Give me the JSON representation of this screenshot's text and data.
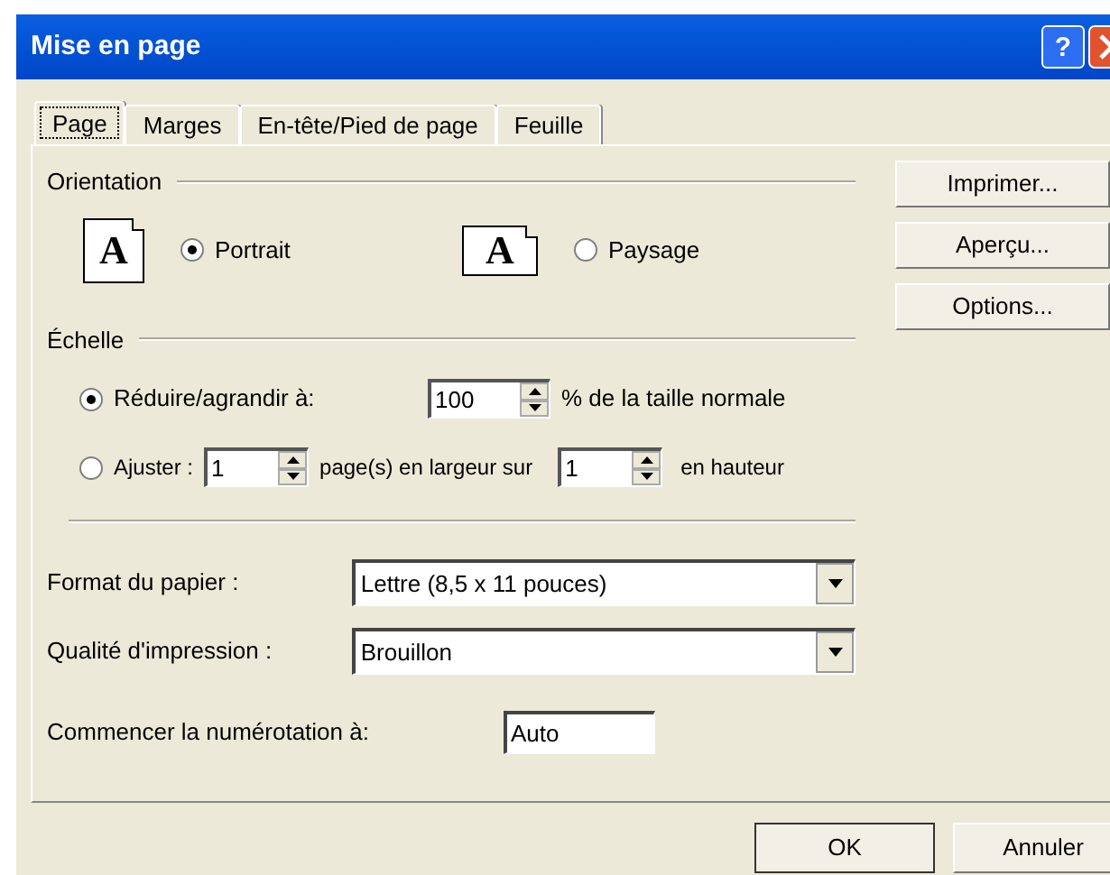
{
  "window": {
    "title": "Mise en page",
    "help_button": "?"
  },
  "tabs": [
    {
      "label": "Page",
      "selected": true
    },
    {
      "label": "Marges",
      "selected": false
    },
    {
      "label": "En-tête/Pied de page",
      "selected": false
    },
    {
      "label": "Feuille",
      "selected": false
    }
  ],
  "orientation": {
    "title": "Orientation",
    "options": [
      {
        "label": "Portrait",
        "kind": "portrait",
        "icon_letter": "A",
        "selected": true
      },
      {
        "label": "Paysage",
        "kind": "landscape",
        "icon_letter": "A",
        "selected": false
      }
    ]
  },
  "scale": {
    "title": "Échelle",
    "reduce": {
      "label": "Réduire/agrandir à:",
      "selected": true,
      "value": "100",
      "suffix": "% de la taille normale"
    },
    "fit": {
      "label": "Ajuster :",
      "selected": false,
      "width_value": "1",
      "middle": "page(s) en largeur sur",
      "height_value": "1",
      "suffix": "en hauteur"
    }
  },
  "paper_size": {
    "label": "Format du papier :",
    "value": "Lettre (8,5 x 11 pouces)"
  },
  "print_quality": {
    "label": "Qualité d'impression :",
    "value": "Brouillon"
  },
  "first_page_number": {
    "label": "Commencer la numérotation à:",
    "value": "Auto"
  },
  "side_buttons": [
    "Imprimer...",
    "Aperçu...",
    "Options..."
  ],
  "buttons": [
    "OK",
    "Annuler"
  ]
}
